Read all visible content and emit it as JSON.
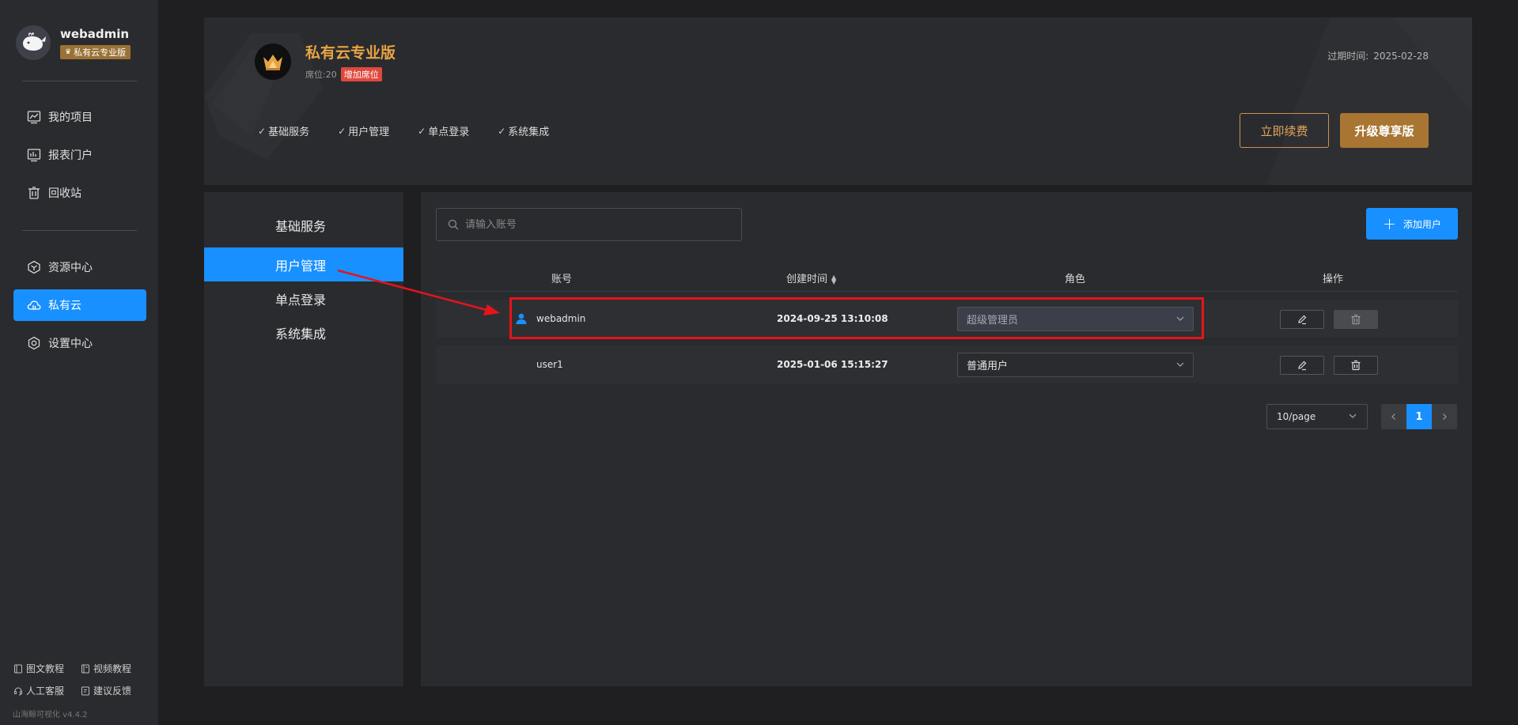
{
  "user": {
    "name": "webadmin",
    "edition_badge": "私有云专业版"
  },
  "sidebar": {
    "items": [
      {
        "label": "我的项目",
        "icon": "chart-line-icon"
      },
      {
        "label": "报表门户",
        "icon": "dashboard-icon"
      },
      {
        "label": "回收站",
        "icon": "trash-icon"
      },
      {
        "label": "资源中心",
        "icon": "cube-icon"
      },
      {
        "label": "私有云",
        "icon": "cloud-icon",
        "active": true
      },
      {
        "label": "设置中心",
        "icon": "gear-icon"
      }
    ],
    "help": [
      {
        "label": "图文教程",
        "icon": "book-icon"
      },
      {
        "label": "视频教程",
        "icon": "video-icon"
      },
      {
        "label": "人工客服",
        "icon": "headset-icon"
      },
      {
        "label": "建议反馈",
        "icon": "feedback-icon"
      }
    ],
    "version": "山海鲸可视化 v4.4.2"
  },
  "plan": {
    "title": "私有云专业版",
    "seats_label": "席位:",
    "seats_value": "20",
    "add_seat": "增加席位",
    "features": [
      "基础服务",
      "用户管理",
      "单点登录",
      "系统集成"
    ],
    "expire_label": "过期时间:",
    "expire_date": "2025-02-28",
    "renew_button": "立即续费",
    "upgrade_button": "升级尊享版",
    "accent_color": "#e8a444"
  },
  "subnav": {
    "items": [
      "基础服务",
      "用户管理",
      "单点登录",
      "系统集成"
    ],
    "active_index": 1
  },
  "users": {
    "search_placeholder": "请输入账号",
    "add_button": "添加用户",
    "columns": {
      "account": "账号",
      "created": "创建时间",
      "role": "角色",
      "actions": "操作"
    },
    "rows": [
      {
        "account": "webadmin",
        "created": "2024-09-25 13:10:08",
        "role": "超级管理员",
        "role_disabled": true
      },
      {
        "account": "user1",
        "created": "2025-01-06 15:15:27",
        "role": "普通用户",
        "role_disabled": false
      }
    ],
    "pagination": {
      "page_size": "10/page",
      "current_page": "1"
    }
  },
  "colors": {
    "primary": "#1890ff",
    "gold": "#a87632",
    "annotation": "#e5141b"
  }
}
